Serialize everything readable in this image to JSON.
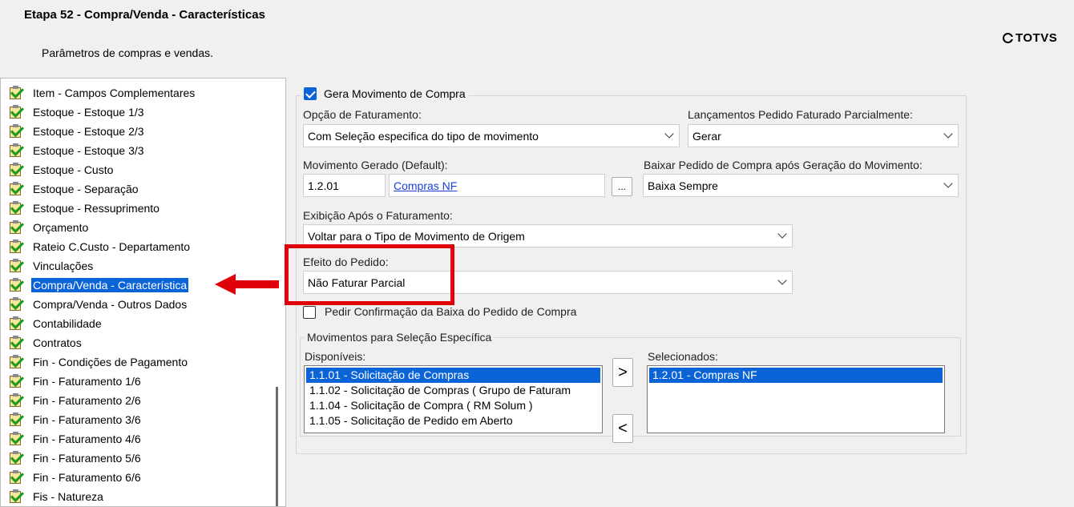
{
  "header": {
    "title": "Etapa 52 - Compra/Venda - Características",
    "subtitle": "Parâmetros de compras e vendas.",
    "logo_text": "TOTVS"
  },
  "tree": {
    "items": [
      "Item - Campos Complementares",
      "Estoque - Estoque 1/3",
      "Estoque - Estoque 2/3",
      "Estoque - Estoque 3/3",
      "Estoque - Custo",
      "Estoque - Separação",
      "Estoque - Ressuprimento",
      "Orçamento",
      "Rateio C.Custo - Departamento",
      "Vinculações",
      "Compra/Venda - Característica",
      "Compra/Venda - Outros Dados",
      "Contabilidade",
      "Contratos",
      "Fin - Condições de Pagamento",
      "Fin - Faturamento 1/6",
      "Fin - Faturamento 2/6",
      "Fin - Faturamento 3/6",
      "Fin - Faturamento 4/6",
      "Fin - Faturamento 5/6",
      "Fin - Faturamento 6/6",
      "Fis - Natureza"
    ],
    "selected": "Compra/Venda - Característica"
  },
  "form": {
    "gera_movimento_label": "Gera Movimento de Compra",
    "gera_movimento_checked": true,
    "opcao_faturamento_label": "Opção de Faturamento:",
    "opcao_faturamento_value": "Com Seleção especifica do tipo de movimento",
    "lancamentos_label": "Lançamentos Pedido Faturado Parcialmente:",
    "lancamentos_value": "Gerar",
    "movimento_gerado_label": "Movimento Gerado (Default):",
    "movimento_gerado_code": "1.2.01",
    "movimento_gerado_name": "Compras NF",
    "browse_button": "...",
    "baixar_pedido_label": "Baixar Pedido de Compra após Geração do Movimento:",
    "baixar_pedido_value": "Baixa Sempre",
    "exibicao_label": "Exibição Após o Faturamento:",
    "exibicao_value": "Voltar para o Tipo de Movimento de Origem",
    "efeito_label": "Efeito do Pedido:",
    "efeito_value": "Não Faturar Parcial",
    "pedir_confirmacao_label": "Pedir Confirmação da Baixa do Pedido de Compra",
    "pedir_confirmacao_checked": false
  },
  "selecao": {
    "group_label": "Movimentos para Seleção Específica",
    "disponiveis_label": "Disponíveis:",
    "disponiveis": [
      "1.1.01 - Solicitação de Compras",
      "1.1.02 - Solicitação de Compras ( Grupo de Faturam",
      "1.1.04 - Solicitação de Compra  ( RM Solum )",
      "1.1.05 - Solicitação de Pedido em Aberto"
    ],
    "selecionados_label": "Selecionados:",
    "selecionados": [
      "1.2.01 - Compras NF"
    ],
    "add_button": ">",
    "remove_button": "<"
  },
  "colors": {
    "selection": "#0a64d8",
    "highlight": "#e0000a",
    "link": "#1a3fd8"
  }
}
